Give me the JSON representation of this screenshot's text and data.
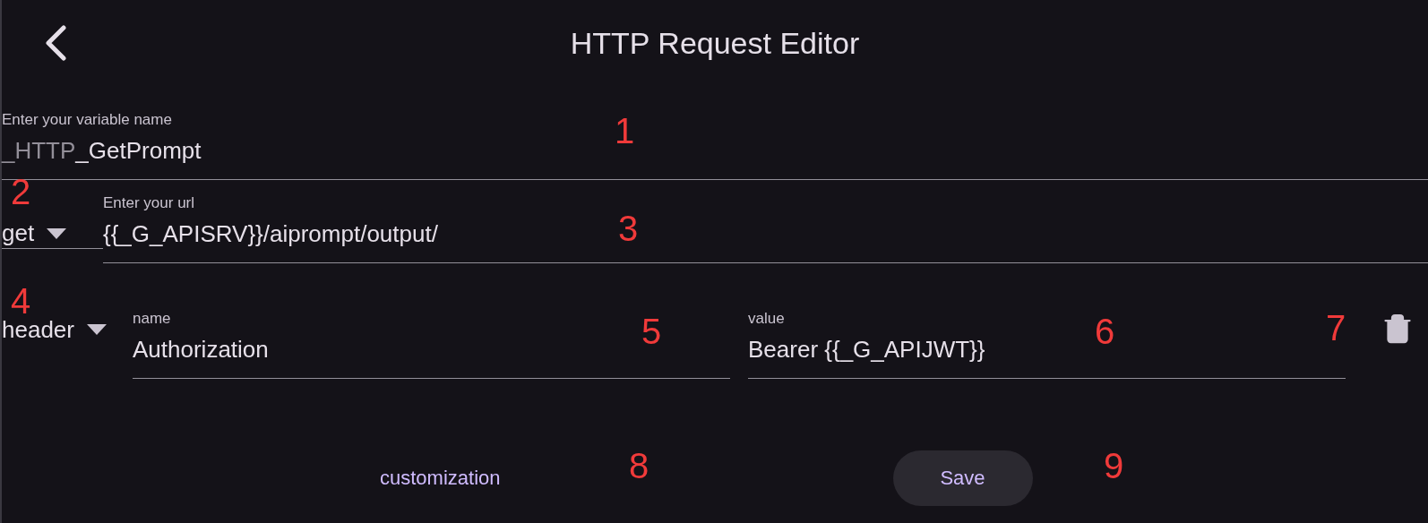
{
  "header": {
    "title": "HTTP Request Editor"
  },
  "variable_field": {
    "label": "Enter your variable name",
    "prefix": "_HTTP",
    "value": "_GetPrompt"
  },
  "method_select": {
    "value": "get"
  },
  "url_field": {
    "label": "Enter your url",
    "value": "{{_G_APISRV}}/aiprompt/output/"
  },
  "params": [
    {
      "type_select": "header",
      "name_label": "name",
      "name": "Authorization",
      "value_label": "value",
      "value": "Bearer {{_G_APIJWT}}"
    }
  ],
  "customization_link": "customization",
  "save_button": "Save",
  "annotations": [
    "1",
    "2",
    "3",
    "4",
    "5",
    "6",
    "7",
    "8",
    "9"
  ]
}
